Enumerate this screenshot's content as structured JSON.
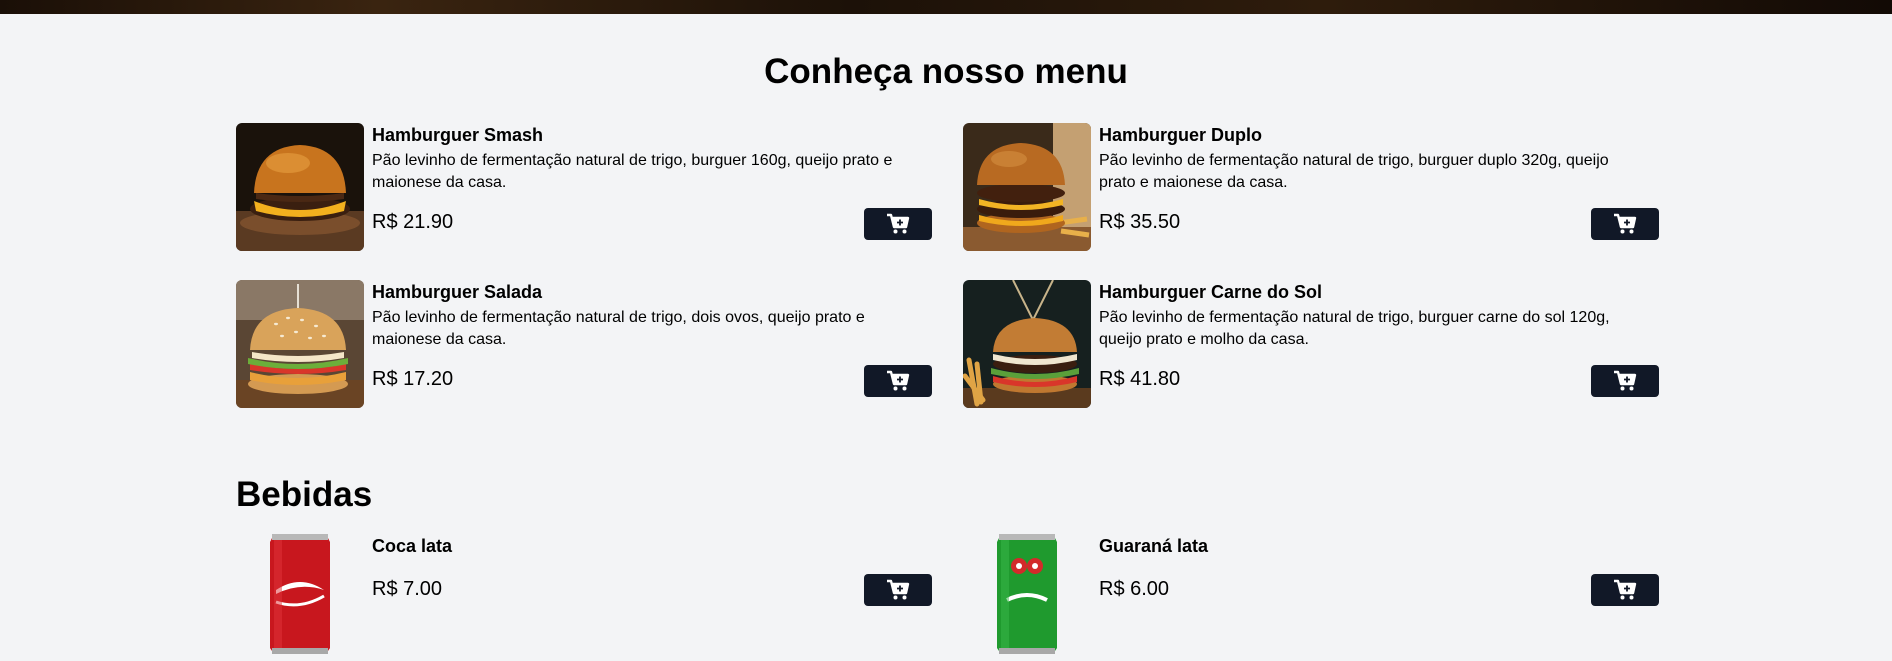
{
  "page": {
    "menu_title": "Conheça nosso menu",
    "drinks_title": "Bebidas"
  },
  "colors": {
    "background": "#f3f4f6",
    "button": "#111827",
    "button_icon": "#ffffff"
  },
  "burgers": [
    {
      "name": "Hamburguer Smash",
      "description": "Pão levinho de fermentação natural de trigo, burguer 160g, queijo prato e maionese da casa.",
      "price": "R$ 21.90",
      "icon": "cart-plus-icon"
    },
    {
      "name": "Hamburguer Duplo",
      "description": "Pão levinho de fermentação natural de trigo, burguer duplo 320g, queijo prato e maionese da casa.",
      "price": "R$ 35.50",
      "icon": "cart-plus-icon"
    },
    {
      "name": "Hamburguer Salada",
      "description": "Pão levinho de fermentação natural de trigo, dois ovos, queijo prato e maionese da casa.",
      "price": "R$ 17.20",
      "icon": "cart-plus-icon"
    },
    {
      "name": "Hamburguer Carne do Sol",
      "description": "Pão levinho de fermentação natural de trigo, burguer carne do sol 120g, queijo prato e molho da casa.",
      "price": "R$ 41.80",
      "icon": "cart-plus-icon"
    }
  ],
  "drinks": [
    {
      "name": "Coca lata",
      "price": "R$ 7.00",
      "icon": "cart-plus-icon"
    },
    {
      "name": "Guaraná lata",
      "price": "R$ 6.00",
      "icon": "cart-plus-icon"
    }
  ]
}
